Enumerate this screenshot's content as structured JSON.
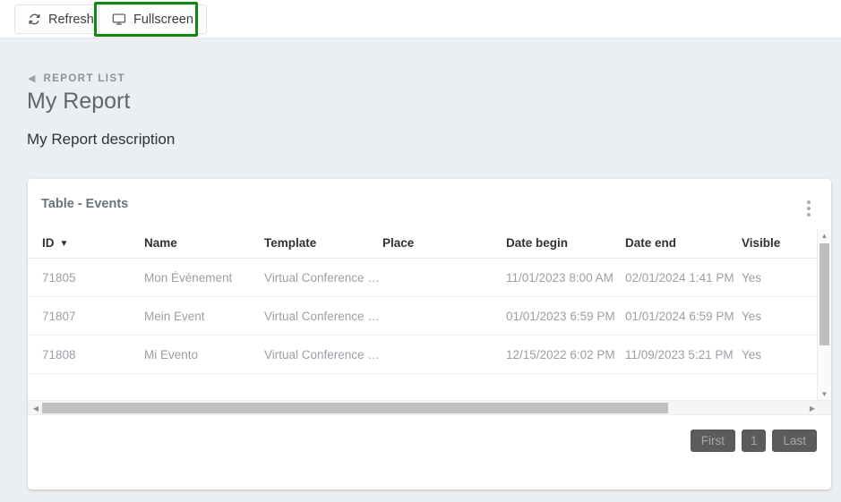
{
  "toolbar": {
    "refresh_label": "Refresh",
    "refresh_icon": "refresh-icon",
    "fullscreen_label": "Fullscreen",
    "fullscreen_icon": "monitor-icon",
    "highlight_color": "#128712"
  },
  "breadcrumb": {
    "arrow_icon": "triangle-left-icon",
    "label": "REPORT LIST"
  },
  "page": {
    "title": "My Report",
    "description": "My Report description"
  },
  "card": {
    "title": "Table - Events",
    "menu_icon": "kebab-menu-icon"
  },
  "table": {
    "columns": [
      {
        "label": "ID",
        "sorted": true,
        "sort_icon": "chevron-down-icon"
      },
      {
        "label": "Name",
        "sorted": false
      },
      {
        "label": "Template",
        "sorted": false
      },
      {
        "label": "Place",
        "sorted": false
      },
      {
        "label": "Date begin",
        "sorted": false
      },
      {
        "label": "Date end",
        "sorted": false
      },
      {
        "label": "Visible",
        "sorted": false
      }
    ],
    "rows": [
      {
        "id": "71805",
        "name": "Mon Événement",
        "template": "Virtual Conference (I...",
        "place": "",
        "date_begin": "11/01/2023 8:00 AM",
        "date_end": "02/01/2024 1:41 PM",
        "visible": "Yes"
      },
      {
        "id": "71807",
        "name": "Mein Event",
        "template": "Virtual Conference (I...",
        "place": "",
        "date_begin": "01/01/2023 6:59 PM",
        "date_end": "01/01/2024 6:59 PM",
        "visible": "Yes"
      },
      {
        "id": "71808",
        "name": "Mi Evento",
        "template": "Virtual Conference (I...",
        "place": "",
        "date_begin": "12/15/2022 6:02 PM",
        "date_end": "11/09/2023 5:21 PM",
        "visible": "Yes"
      }
    ]
  },
  "scrollbars": {
    "vertical_up_icon": "triangle-up-icon",
    "vertical_down_icon": "triangle-down-icon",
    "horizontal_left_icon": "triangle-left-icon",
    "horizontal_right_icon": "triangle-right-icon"
  },
  "pagination": {
    "first_label": "First",
    "current_page": "1",
    "last_label": "Last"
  }
}
